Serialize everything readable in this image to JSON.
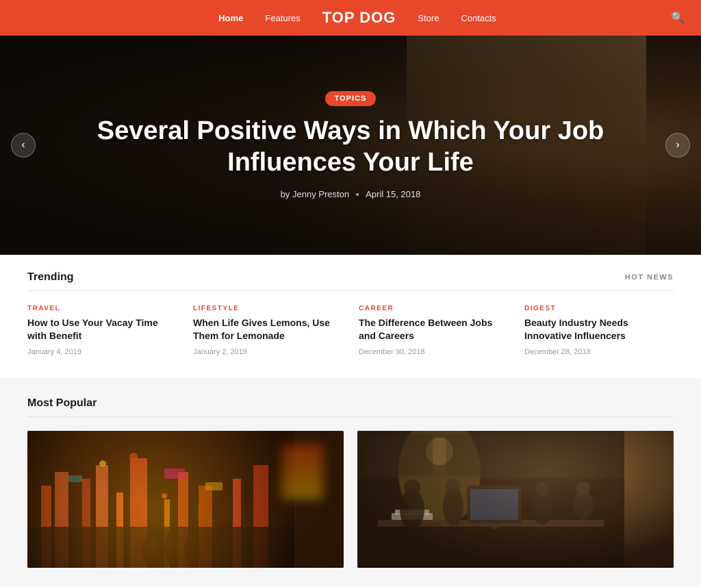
{
  "header": {
    "logo": "TOP DOG",
    "nav": [
      {
        "label": "Home",
        "active": true
      },
      {
        "label": "Features",
        "active": false
      },
      {
        "label": "Store",
        "active": false
      },
      {
        "label": "Contacts",
        "active": false
      }
    ],
    "search_icon": "🔍"
  },
  "hero": {
    "badge": "TOPICS",
    "title": "Several Positive Ways in Which Your Job Influences Your Life",
    "author": "by Jenny Preston",
    "date": "April 15, 2018",
    "prev_arrow": "‹",
    "next_arrow": "›"
  },
  "trending": {
    "title": "Trending",
    "hot_news_label": "HOT NEWS",
    "cards": [
      {
        "category": "TRAVEL",
        "title": "How to Use Your Vacay Time with Benefit",
        "date": "January 4, 2019"
      },
      {
        "category": "LIFESTYLE",
        "title": "When Life Gives Lemons, Use Them for Lemonade",
        "date": "January 2, 2019"
      },
      {
        "category": "CAREER",
        "title": "The Difference Between Jobs and Careers",
        "date": "December 30, 2018"
      },
      {
        "category": "DIGEST",
        "title": "Beauty Industry Needs Innovative Influencers",
        "date": "December 28, 2018"
      }
    ]
  },
  "popular": {
    "title": "Most Popular",
    "cards": [
      {
        "alt": "City night street with neon lights"
      },
      {
        "alt": "Team working at computers in office"
      }
    ]
  }
}
